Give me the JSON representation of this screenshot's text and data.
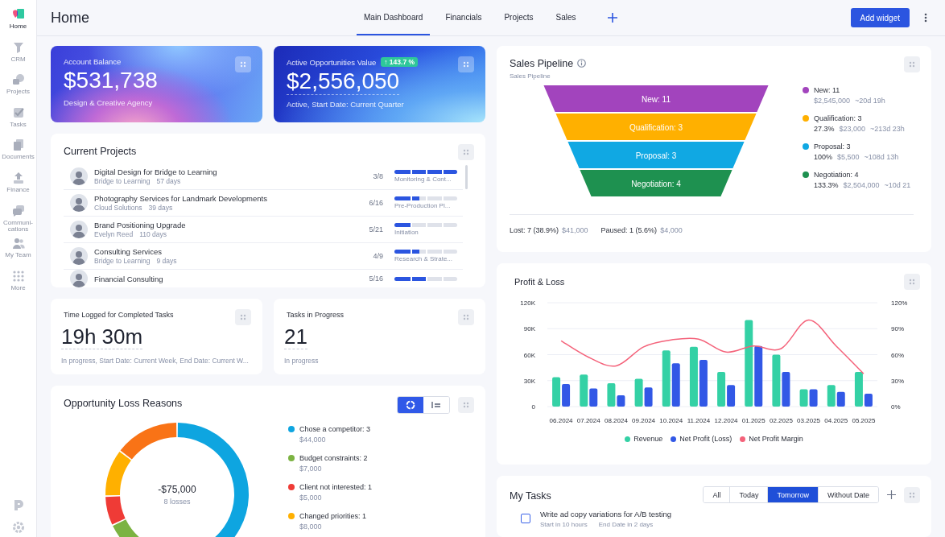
{
  "sidebar": {
    "items": [
      {
        "label": "Home",
        "selected": true
      },
      {
        "label": "CRM",
        "selected": false
      },
      {
        "label": "Projects",
        "selected": false
      },
      {
        "label": "Tasks",
        "selected": false
      },
      {
        "label": "Documents",
        "selected": false
      },
      {
        "label": "Finance",
        "selected": false
      },
      {
        "label": "Communi-cations",
        "selected": false
      },
      {
        "label": "My Team",
        "selected": false
      },
      {
        "label": "More",
        "selected": false
      }
    ]
  },
  "header": {
    "title": "Home",
    "tabs": [
      {
        "label": "Main Dashboard",
        "selected": true
      },
      {
        "label": "Financials",
        "selected": false
      },
      {
        "label": "Projects",
        "selected": false
      },
      {
        "label": "Sales",
        "selected": false
      }
    ],
    "add_button": "Add widget"
  },
  "summary_cards": [
    {
      "kind": "balance",
      "label": "Account Balance",
      "value": "$531,738",
      "note": "Design & Creative Agency"
    },
    {
      "kind": "opportunities",
      "label": "Active Opportunities Value",
      "badge": "↑ 143.7 %",
      "value": "$2,556,050",
      "note": "Active, Start Date: Current Quarter"
    }
  ],
  "projects": {
    "title": "Current Projects",
    "rows": [
      {
        "name": "Digital Design for Bridge to Learning",
        "client": "Bridge to Learning",
        "days": "57 days",
        "count": "3/8",
        "level": 1,
        "stage": "Monitoring & Cont..."
      },
      {
        "name": "Photography Services for Landmark Developments",
        "client": "Cloud Solutions",
        "days": "39 days",
        "count": "6/16",
        "level": 0.4,
        "stage": "Pre-Production Pl..."
      },
      {
        "name": "Brand Positioning Upgrade",
        "client": "Evelyn Reed",
        "days": "110 days",
        "count": "5/21",
        "level": 0.25,
        "stage": "Initiation"
      },
      {
        "name": "Consulting Services",
        "client": "Bridge to Learning",
        "days": "9 days",
        "count": "4/9",
        "level": 0.4,
        "stage": "Research & Strate..."
      },
      {
        "name": "Financial Consulting",
        "count": "5/16",
        "level": 0.5
      }
    ]
  },
  "stats": [
    {
      "title": "Time Logged for Completed Tasks",
      "value": "19h 30m",
      "note": "In progress, Start Date: Current Week, End Date: Current W..."
    },
    {
      "title": "Tasks in Progress",
      "value": "21",
      "note": "In progress"
    }
  ],
  "loss_reasons": {
    "title": "Opportunity Loss Reasons",
    "views": [
      {
        "kind": "donut",
        "selected": true
      },
      {
        "kind": "list",
        "selected": false
      }
    ],
    "total": "-$75,000",
    "count": "8 losses",
    "chart_data": {
      "type": "donut",
      "values": [
        58.6,
        9.3,
        6.7,
        10.7,
        14.7
      ],
      "colors": [
        "#0ea5e0",
        "#7cb342",
        "#ef3b36",
        "#ffb000",
        "#f97316"
      ]
    },
    "reasons": [
      {
        "label": "Chose a competitor: 3",
        "amount": "$44,000",
        "color": "#0ea5e0"
      },
      {
        "label": "Budget constraints: 2",
        "amount": "$7,000",
        "color": "#7cb342"
      },
      {
        "label": "Client not interested: 1",
        "amount": "$5,000",
        "color": "#ef3b36"
      },
      {
        "label": "Changed priorities: 1",
        "amount": "$8,000",
        "color": "#ffb000"
      }
    ]
  },
  "pipeline": {
    "title": "Sales Pipeline",
    "subtitle": "Sales Pipeline",
    "stages": [
      {
        "funnel_label": "New: 11",
        "legend_label": "New: 11",
        "amount": "$2,545,000",
        "time": "~20d 19h",
        "color": "#a244bd"
      },
      {
        "funnel_label": "Qualification: 3",
        "legend_label": "Qualification: 3",
        "pct": "27.3%",
        "amount": "$23,000",
        "time": "~213d 23h",
        "color": "#ffb000"
      },
      {
        "funnel_label": "Proposal: 3",
        "legend_label": "Proposal: 3",
        "pct": "100%",
        "amount": "$5,500",
        "time": "~108d 13h",
        "color": "#10a8e3"
      },
      {
        "funnel_label": "Negotiation: 4",
        "legend_label": "Negotiation: 4",
        "pct": "133.3%",
        "amount": "$2,504,000",
        "time": "~10d 21",
        "color": "#1e9150"
      }
    ],
    "lost": "Lost: 7 (38.9%)",
    "lost_amount": "$41,000",
    "paused": "Paused: 1 (5.6%)",
    "paused_amount": "$4,000"
  },
  "profit_loss": {
    "title": "Profit & Loss",
    "chart_data": {
      "type": "bar",
      "categories": [
        "06.2024",
        "07.2024",
        "08.2024",
        "09.2024",
        "10.2024",
        "11.2024",
        "12.2024",
        "01.2025",
        "02.2025",
        "03.2025",
        "04.2025",
        "05.2025"
      ],
      "series": [
        {
          "name": "Revenue",
          "color": "#34d1a5",
          "values": [
            34000,
            37000,
            27000,
            32000,
            65000,
            69000,
            40000,
            100000,
            60000,
            20000,
            25000,
            40000
          ]
        },
        {
          "name": "Net Profit (Loss)",
          "color": "#3258e6",
          "values": [
            26000,
            21000,
            13000,
            22000,
            50000,
            54000,
            25000,
            70000,
            40000,
            20000,
            17000,
            15000
          ]
        },
        {
          "name": "Net Profit Margin",
          "color": "#f4627a",
          "type": "line",
          "axis": "y2",
          "values": [
            76,
            57,
            47,
            69,
            77,
            78,
            63,
            70,
            67,
            100,
            70,
            38
          ]
        }
      ],
      "grid": true,
      "legend": "bottom",
      "ylim": [
        0,
        120000
      ],
      "y2lim": [
        0,
        120
      ],
      "yticks": [
        {
          "value": 0,
          "label": "0"
        },
        {
          "value": 30000,
          "label": "30K"
        },
        {
          "value": 60000,
          "label": "60K"
        },
        {
          "value": 90000,
          "label": "90K"
        },
        {
          "value": 120000,
          "label": "120K"
        }
      ],
      "y2ticks": [
        {
          "value": 0,
          "label": "0%"
        },
        {
          "value": 30,
          "label": "30%"
        },
        {
          "value": 60,
          "label": "60%"
        },
        {
          "value": 90,
          "label": "90%"
        },
        {
          "value": 120,
          "label": "120%"
        }
      ]
    }
  },
  "tasks": {
    "title": "My Tasks",
    "filters": [
      {
        "label": "All",
        "selected": false
      },
      {
        "label": "Today",
        "selected": false
      },
      {
        "label": "Tomorrow",
        "selected": true
      },
      {
        "label": "Without Date",
        "selected": false
      }
    ],
    "items": [
      {
        "title": "Write ad copy variations for A/B testing",
        "start": "Start in 10 hours",
        "end": "End Date in 2 days",
        "checked": false
      }
    ]
  }
}
